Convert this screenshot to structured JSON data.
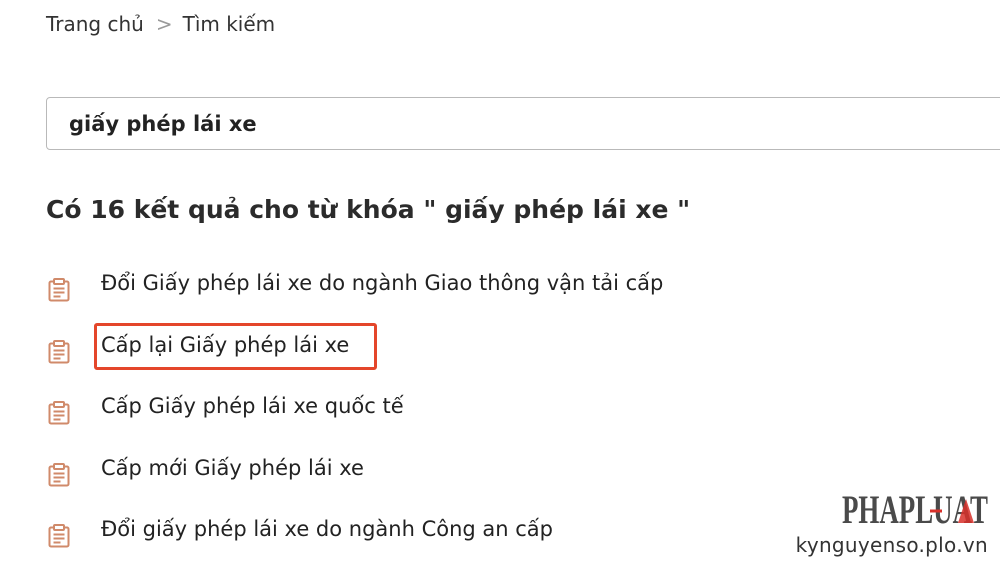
{
  "breadcrumb": {
    "home": "Trang chủ",
    "separator": ">",
    "current": "Tìm kiếm"
  },
  "search": {
    "value": "giấy phép lái xe"
  },
  "results": {
    "heading": "Có 16 kết quả cho từ khóa \" giấy phép lái xe \"",
    "items": [
      {
        "label": "Đổi Giấy phép lái xe do ngành Giao thông vận tải cấp",
        "icon": "document-icon"
      },
      {
        "label": "Cấp lại Giấy phép lái xe",
        "icon": "document-icon",
        "highlighted": true
      },
      {
        "label": "Cấp Giấy phép lái xe quốc tế",
        "icon": "document-icon"
      },
      {
        "label": "Cấp mới Giấy phép lái xe",
        "icon": "document-icon"
      },
      {
        "label": "Đổi giấy phép lái xe do ngành Công an cấp",
        "icon": "document-icon"
      }
    ]
  },
  "watermark": {
    "brand": "PHAPLUAT",
    "site": "kynguyenso.plo.vn"
  },
  "colors": {
    "icon": "#d08a6a",
    "highlight": "#e4462a",
    "brand": "#4a4a4a",
    "brand_accent": "#d8302a"
  }
}
